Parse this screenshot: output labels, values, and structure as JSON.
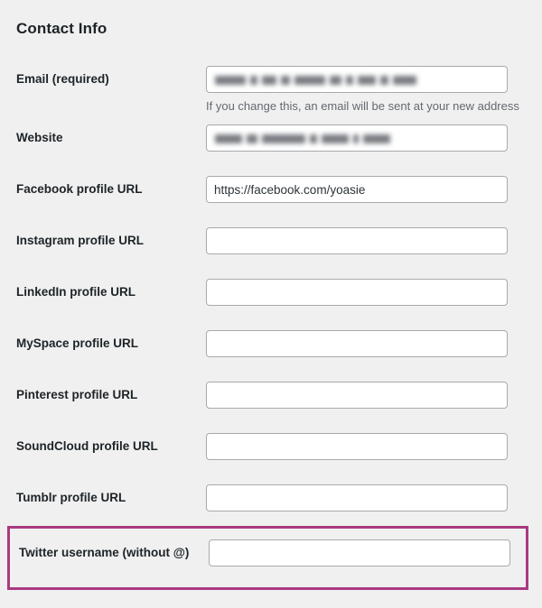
{
  "section": {
    "title": "Contact Info"
  },
  "colors": {
    "page_background": "#f0f0f0",
    "label_text": "#1d2327",
    "description_text": "#646970",
    "input_border": "#a7aaad",
    "input_background": "#ffffff",
    "highlight_border": "#a93a80"
  },
  "fields": [
    {
      "label": "Email (required)",
      "value": "",
      "placeholder": "",
      "redacted": true,
      "description": "If you change this, an email will be sent at your new address",
      "highlighted": false
    },
    {
      "label": "Website",
      "value": "",
      "placeholder": "",
      "redacted": true,
      "description": "",
      "highlighted": false
    },
    {
      "label": "Facebook profile URL",
      "value": "https://facebook.com/yoasie",
      "placeholder": "",
      "redacted": false,
      "description": "",
      "highlighted": false
    },
    {
      "label": "Instagram profile URL",
      "value": "",
      "placeholder": "",
      "redacted": false,
      "description": "",
      "highlighted": false
    },
    {
      "label": "LinkedIn profile URL",
      "value": "",
      "placeholder": "",
      "redacted": false,
      "description": "",
      "highlighted": false
    },
    {
      "label": "MySpace profile URL",
      "value": "",
      "placeholder": "",
      "redacted": false,
      "description": "",
      "highlighted": false
    },
    {
      "label": "Pinterest profile URL",
      "value": "",
      "placeholder": "",
      "redacted": false,
      "description": "",
      "highlighted": false
    },
    {
      "label": "SoundCloud profile URL",
      "value": "",
      "placeholder": "",
      "redacted": false,
      "description": "",
      "highlighted": false
    },
    {
      "label": "Tumblr profile URL",
      "value": "",
      "placeholder": "",
      "redacted": false,
      "description": "",
      "highlighted": false
    },
    {
      "label": "Twitter username (without @)",
      "value": "",
      "placeholder": "",
      "redacted": false,
      "description": "",
      "highlighted": true
    }
  ],
  "redaction_blocks": {
    "email": [
      34,
      8,
      16,
      10,
      34,
      13,
      8,
      20,
      9,
      26
    ],
    "website": [
      30,
      12,
      48,
      8,
      30,
      6,
      30
    ]
  }
}
